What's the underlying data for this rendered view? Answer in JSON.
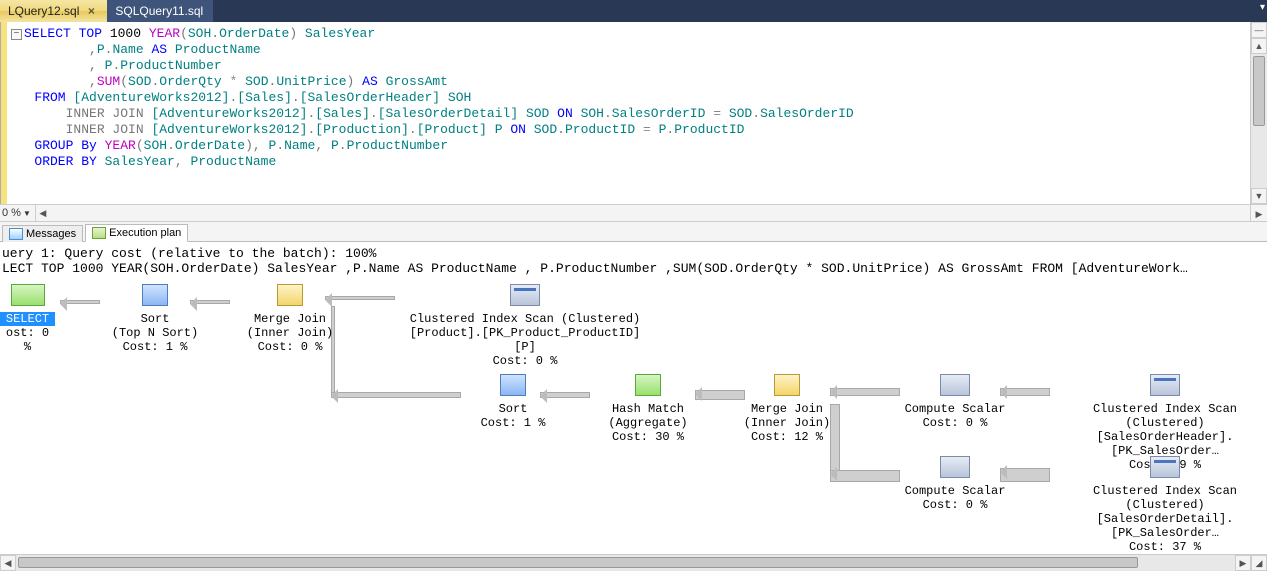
{
  "tabs": {
    "items": [
      {
        "label": "LQuery12.sql",
        "active": true
      },
      {
        "label": "SQLQuery11.sql",
        "active": false
      }
    ]
  },
  "editor": {
    "zoom": "0 %",
    "sql": {
      "l1a": "SELECT",
      "l1b": " TOP",
      "l1c": " 1000",
      "l1d": " YEAR",
      "l1e": "(",
      "l1f": "SOH",
      "l1g": ".",
      "l1h": "OrderDate",
      "l1i": ")",
      "l1j": " SalesYear",
      "l2a": "       ,",
      "l2b": "P",
      "l2c": ".",
      "l2d": "Name",
      "l2e": " AS",
      "l2f": " ProductName",
      "l3a": "       ,",
      "l3b": " P",
      "l3c": ".",
      "l3d": "ProductNumber",
      "l4a": "       ,",
      "l4b": "SUM",
      "l4c": "(",
      "l4d": "SOD",
      "l4e": ".",
      "l4f": "OrderQty",
      "l4g": " *",
      "l4h": " SOD",
      "l4i": ".",
      "l4j": "UnitPrice",
      "l4k": ")",
      "l4l": " AS",
      "l4m": " GrossAmt",
      "l5a": "FROM",
      "l5b": " [AdventureWorks2012]",
      "l5c": ".",
      "l5d": "[Sales]",
      "l5e": ".",
      "l5f": "[SalesOrderHeader]",
      "l5g": " SOH",
      "l6a": "    INNER",
      "l6b": " JOIN",
      "l6c": " [AdventureWorks2012]",
      "l6d": ".",
      "l6e": "[Sales]",
      "l6f": ".",
      "l6g": "[SalesOrderDetail]",
      "l6h": " SOD",
      "l6i": " ON",
      "l6j": " SOH",
      "l6k": ".",
      "l6l": "SalesOrderID",
      "l6m": " =",
      "l6n": " SOD",
      "l6o": ".",
      "l6p": "SalesOrderID",
      "l7a": "    INNER",
      "l7b": " JOIN",
      "l7c": " [AdventureWorks2012]",
      "l7d": ".",
      "l7e": "[Production]",
      "l7f": ".",
      "l7g": "[Product]",
      "l7h": " P",
      "l7i": " ON",
      "l7j": " SOD",
      "l7k": ".",
      "l7l": "ProductID",
      "l7m": " =",
      "l7n": " P",
      "l7o": ".",
      "l7p": "ProductID",
      "l8a": "GROUP",
      "l8b": " By",
      "l8c": " YEAR",
      "l8d": "(",
      "l8e": "SOH",
      "l8f": ".",
      "l8g": "OrderDate",
      "l8h": "),",
      "l8i": " P",
      "l8j": ".",
      "l8k": "Name",
      "l8l": ",",
      "l8m": " P",
      "l8n": ".",
      "l8o": "ProductNumber",
      "l9a": "ORDER",
      "l9b": " BY",
      "l9c": " SalesYear",
      "l9d": ",",
      "l9e": " ProductName"
    }
  },
  "lower_tabs": {
    "messages": "Messages",
    "plan": "Execution plan"
  },
  "plan": {
    "summary_l1": "uery 1: Query cost (relative to the batch): 100%",
    "summary_l2": "LECT TOP 1000 YEAR(SOH.OrderDate) SalesYear ,P.Name AS ProductName , P.ProductNumber ,SUM(SOD.OrderQty * SOD.UnitPrice) AS GrossAmt FROM [AdventureWork…",
    "nodes": {
      "select": {
        "l1": "SELECT",
        "l2": "ost: 0 %"
      },
      "sort1": {
        "l1": "Sort",
        "l2": "(Top N Sort)",
        "l3": "Cost: 1 %"
      },
      "merge1": {
        "l1": "Merge Join",
        "l2": "(Inner Join)",
        "l3": "Cost: 0 %"
      },
      "scan_prod": {
        "l1": "Clustered Index Scan (Clustered)",
        "l2": "[Product].[PK_Product_ProductID] [P]",
        "l3": "Cost: 0 %"
      },
      "sort2": {
        "l1": "Sort",
        "l2": "Cost: 1 %"
      },
      "hash": {
        "l1": "Hash Match",
        "l2": "(Aggregate)",
        "l3": "Cost: 30 %"
      },
      "merge2": {
        "l1": "Merge Join",
        "l2": "(Inner Join)",
        "l3": "Cost: 12 %"
      },
      "compute1": {
        "l1": "Compute Scalar",
        "l2": "Cost: 0 %"
      },
      "scan_soh": {
        "l1": "Clustered Index Scan (Clustered)",
        "l2": "[SalesOrderHeader].[PK_SalesOrder…",
        "l3": "Cost: 19 %"
      },
      "compute2": {
        "l1": "Compute Scalar",
        "l2": "Cost: 0 %"
      },
      "scan_sod": {
        "l1": "Clustered Index Scan (Clustered)",
        "l2": "[SalesOrderDetail].[PK_SalesOrder…",
        "l3": "Cost: 37 %"
      }
    }
  }
}
